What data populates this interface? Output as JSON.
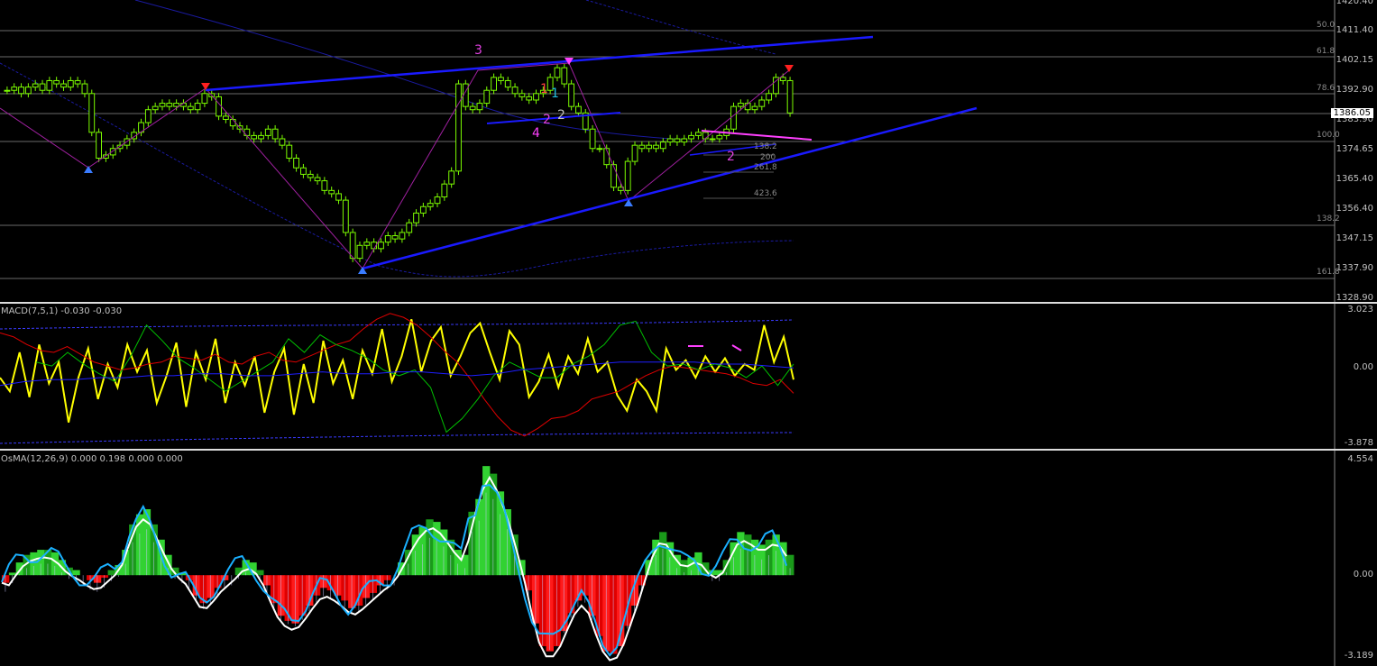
{
  "chart_data": [
    {
      "type": "candlestick",
      "panel": "main",
      "ylim": [
        1328.9,
        1420.4
      ],
      "price_axis_labels": [
        "1420.40",
        "1411.40",
        "1402.15",
        "1392.90",
        "1383.90",
        "1374.65",
        "1365.40",
        "1356.40",
        "1347.15",
        "1337.90",
        "1328.90"
      ],
      "current_price": "1386.05",
      "fib_levels_right": [
        "50.0",
        "61.8",
        "78.6",
        "100.0",
        "138.2",
        "161.8"
      ],
      "fib_levels_inner": [
        "138.2",
        "200",
        "261.8",
        "423.6"
      ],
      "wave_labels": [
        "3",
        "1",
        "1",
        "2",
        "2",
        "4",
        "2"
      ],
      "closes": [
        1393,
        1394,
        1392,
        1394,
        1395,
        1393,
        1396,
        1395,
        1394,
        1396,
        1395,
        1392,
        1380,
        1372,
        1373,
        1375,
        1376,
        1378,
        1380,
        1383,
        1387,
        1388,
        1389,
        1388,
        1389,
        1388,
        1387,
        1389,
        1392,
        1391,
        1385,
        1384,
        1382,
        1381,
        1379,
        1378,
        1379,
        1381,
        1378,
        1376,
        1372,
        1369,
        1367,
        1366,
        1365,
        1362,
        1361,
        1359,
        1349,
        1341,
        1345,
        1346,
        1344,
        1346,
        1348,
        1347,
        1349,
        1352,
        1355,
        1357,
        1358,
        1360,
        1364,
        1368,
        1395,
        1388,
        1387,
        1389,
        1393,
        1397,
        1396,
        1394,
        1392,
        1391,
        1390,
        1392,
        1393,
        1397,
        1400,
        1395,
        1388,
        1386,
        1381,
        1375,
        1375,
        1370,
        1363,
        1362,
        1371,
        1376,
        1375,
        1376,
        1375,
        1377,
        1378,
        1377,
        1378,
        1379,
        1380,
        1378,
        1378,
        1379,
        1381,
        1388,
        1389,
        1387,
        1388,
        1390,
        1392,
        1397,
        1396,
        1386
      ]
    },
    {
      "type": "line",
      "panel": "macd",
      "title": "MACD(7,5,1) -0.030 -0.030",
      "ylim": [
        -3.878,
        3.023
      ],
      "axis_labels": [
        "3.023",
        "0.00",
        "-3.878"
      ],
      "series": [
        {
          "name": "yellow",
          "color": "#ffff00",
          "values": [
            -0.5,
            -1.2,
            0.8,
            -1.5,
            1.2,
            -0.8,
            0.3,
            -2.8,
            -0.5,
            1.0,
            -1.6,
            0.2,
            -1.0,
            1.2,
            -0.2,
            0.9,
            -1.8,
            -0.4,
            1.3,
            -2.0,
            0.8,
            -0.6,
            1.5,
            -1.8,
            0.3,
            -0.9,
            0.6,
            -2.3,
            -0.2,
            1.0,
            -2.4,
            0.2,
            -1.8,
            1.4,
            -0.8,
            0.4,
            -1.6,
            0.9,
            -0.3,
            2.0,
            -0.7,
            0.6,
            2.5,
            -0.2,
            1.4,
            2.1,
            -0.4,
            0.6,
            1.8,
            2.3,
            0.8,
            -0.6,
            1.9,
            1.2,
            -1.5,
            -0.7,
            0.7,
            -1.0,
            0.6,
            -0.3,
            1.5,
            -0.2,
            0.3,
            -1.4,
            -2.2,
            -0.6,
            -1.2,
            -2.2,
            1.0,
            -0.1,
            0.4,
            -0.5,
            0.6,
            -0.2,
            0.5,
            -0.4,
            0.2,
            -0.1,
            2.2,
            0.3,
            1.6,
            -0.6
          ]
        },
        {
          "name": "red",
          "color": "#e00000",
          "values": [
            1.8,
            1.6,
            1.2,
            0.9,
            0.8,
            1.1,
            0.7,
            0.3,
            0.1,
            -0.1,
            0.0,
            0.2,
            0.3,
            0.6,
            0.5,
            0.4,
            0.7,
            0.3,
            0.2,
            0.6,
            0.8,
            0.4,
            0.3,
            0.6,
            0.9,
            1.2,
            1.4,
            2.0,
            2.5,
            2.8,
            2.6,
            2.2,
            1.6,
            0.9,
            0.3,
            -0.6,
            -1.6,
            -2.5,
            -3.2,
            -3.5,
            -3.1,
            -2.6,
            -2.5,
            -2.2,
            -1.6,
            -1.4,
            -1.2,
            -0.8,
            -0.4,
            -0.1,
            0.1,
            0.0,
            -0.1,
            -0.2,
            -0.3,
            -0.5,
            -0.8,
            -0.9,
            -0.6,
            -1.3
          ]
        },
        {
          "name": "green",
          "color": "#00c000",
          "values": [
            0.3,
            0.1,
            0.8,
            0.2,
            -0.3,
            -0.7,
            0.6,
            2.2,
            1.4,
            0.5,
            0.0,
            -0.6,
            -1.2,
            -0.7,
            -0.2,
            0.3,
            1.5,
            0.8,
            1.7,
            1.2,
            0.9,
            0.5,
            -0.1,
            -0.4,
            -0.1,
            -1.0,
            -3.3,
            -2.6,
            -1.6,
            -0.4,
            0.3,
            -0.1,
            -0.5,
            -0.5,
            0.2,
            0.6,
            1.2,
            2.2,
            2.4,
            0.8,
            0.1,
            0.2,
            -0.1,
            0.2,
            0.0,
            -0.5,
            0.1,
            -0.9,
            0.2
          ]
        },
        {
          "name": "blue",
          "color": "#1e1eff",
          "values": [
            -0.9,
            -0.7,
            -0.6,
            -0.6,
            -0.5,
            -0.5,
            -0.4,
            -0.4,
            -0.3,
            -0.3,
            -0.4,
            -0.4,
            -0.3,
            -0.2,
            -0.3,
            -0.3,
            -0.2,
            -0.2,
            -0.3,
            -0.4,
            -0.3,
            -0.1,
            0.0,
            0.1,
            0.2,
            0.3,
            0.3,
            0.3,
            0.3,
            0.2,
            0.2,
            0.1,
            0.0
          ]
        }
      ]
    },
    {
      "type": "bar",
      "panel": "osma",
      "title": "OsMA(12,26,9) 0.000 0.198 0.000 0.000",
      "ylim": [
        -3.189,
        4.554
      ],
      "axis_labels": [
        "4.554",
        "0.00",
        "-3.189"
      ],
      "values": [
        -0.3,
        0.1,
        0.5,
        0.8,
        0.9,
        1.0,
        1.0,
        0.9,
        0.6,
        0.3,
        0.2,
        0.0,
        -0.2,
        -0.3,
        -0.1,
        0.2,
        0.4,
        1.0,
        2.0,
        2.4,
        2.6,
        2.0,
        1.4,
        0.8,
        0.3,
        0.1,
        -0.2,
        -0.8,
        -1.1,
        -0.9,
        -0.5,
        -0.2,
        0.0,
        0.3,
        0.6,
        0.5,
        0.2,
        -0.4,
        -1.1,
        -1.6,
        -1.8,
        -1.9,
        -1.6,
        -1.2,
        -0.8,
        -0.5,
        -0.6,
        -0.8,
        -1.0,
        -1.3,
        -1.2,
        -0.9,
        -0.7,
        -0.4,
        -0.2,
        0.0,
        0.5,
        1.0,
        1.6,
        1.9,
        2.2,
        2.1,
        1.8,
        1.4,
        1.0,
        0.8,
        2.5,
        3.0,
        4.3,
        4.0,
        3.3,
        2.6,
        1.6,
        0.6,
        -0.6,
        -1.9,
        -2.8,
        -3.0,
        -2.8,
        -2.2,
        -1.5,
        -1.0,
        -0.8,
        -1.6,
        -2.4,
        -3.0,
        -3.1,
        -2.8,
        -2.0,
        -1.2,
        -0.4,
        0.6,
        1.4,
        1.7,
        1.3,
        0.8,
        0.6,
        0.7,
        0.9,
        0.5,
        0.2,
        0.2,
        0.6,
        1.3,
        1.7,
        1.6,
        1.4,
        1.2,
        1.4,
        1.6,
        1.3,
        0.8
      ]
    }
  ]
}
